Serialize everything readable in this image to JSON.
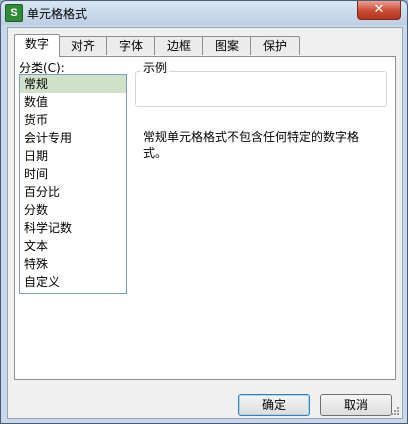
{
  "window": {
    "title": "单元格格式",
    "close_glyph": "✕"
  },
  "tabs": [
    {
      "label": "数字",
      "active": true
    },
    {
      "label": "对齐"
    },
    {
      "label": "字体"
    },
    {
      "label": "边框"
    },
    {
      "label": "图案"
    },
    {
      "label": "保护"
    }
  ],
  "category": {
    "label": "分类(C):",
    "items": [
      "常规",
      "数值",
      "货币",
      "会计专用",
      "日期",
      "时间",
      "百分比",
      "分数",
      "科学记数",
      "文本",
      "特殊",
      "自定义"
    ],
    "selected": "常规"
  },
  "sample": {
    "label": "示例",
    "value": ""
  },
  "description": "常规单元格格式不包含任何特定的数字格式。",
  "buttons": {
    "ok": "确定",
    "cancel": "取消"
  },
  "colors": {
    "title_bg": "#c9d9ea",
    "close_red": "#c84b35",
    "selected_item": "#cfe1c8",
    "default_button_border": "#3c7fb1"
  },
  "icons": {
    "app": "spreadsheet-app-icon",
    "close": "close-icon"
  }
}
